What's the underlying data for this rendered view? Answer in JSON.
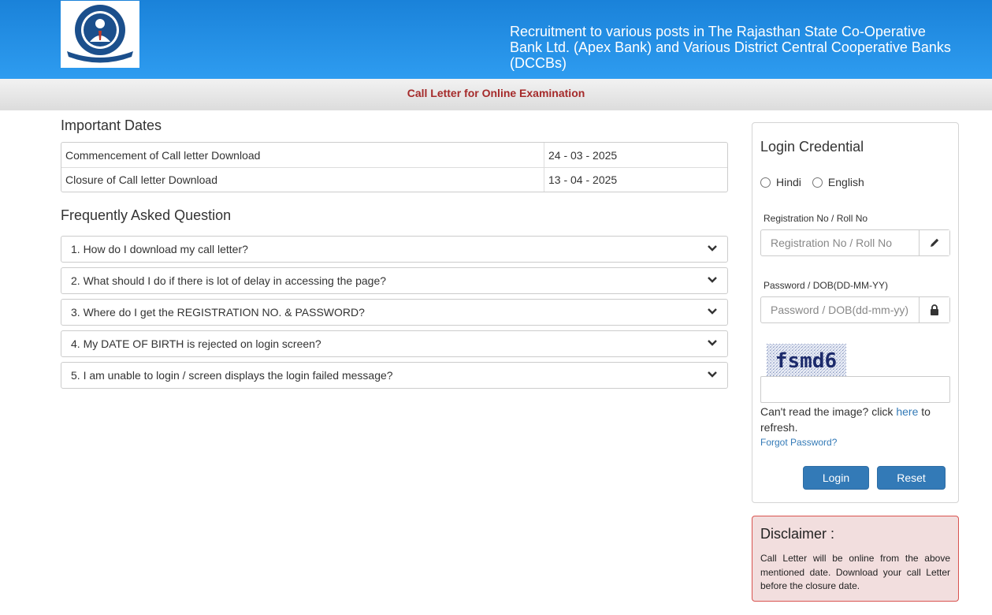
{
  "header": {
    "title": "Recruitment to various posts in The Rajasthan State Co-Operative Bank Ltd. (Apex Bank) and Various District Central Cooperative Banks (DCCBs)"
  },
  "subbar": {
    "text": "Call Letter for Online Examination"
  },
  "important_dates": {
    "heading": "Important Dates",
    "rows": [
      {
        "label": "Commencement of Call letter Download",
        "value": "24 - 03 - 2025"
      },
      {
        "label": "Closure of Call letter Download",
        "value": "13 - 04 - 2025"
      }
    ]
  },
  "faq": {
    "heading": "Frequently Asked Question",
    "items": [
      "1. How do I download my call letter?",
      "2. What should I do if there is lot of delay in accessing the page?",
      "3. Where do I get the REGISTRATION NO. & PASSWORD?",
      "4. My DATE OF BIRTH is rejected on login screen?",
      "5. I am unable to login / screen displays the login failed message?"
    ]
  },
  "login": {
    "title": "Login Credential",
    "language_options": [
      "Hindi",
      "English"
    ],
    "registration_label": "Registration No / Roll No",
    "registration_placeholder": "Registration No / Roll No",
    "password_label": "Password / DOB(DD-MM-YY)",
    "password_placeholder": "Password / DOB(dd-mm-yy)",
    "captcha_text": "fsmd6",
    "captcha_help_prefix": "Can't read the image? click ",
    "captcha_help_link": "here",
    "captcha_help_suffix": " to refresh.",
    "forgot_password": "Forgot Password?",
    "login_button": "Login",
    "reset_button": "Reset"
  },
  "disclaimer": {
    "title": "Disclaimer :",
    "text": "Call Letter will be online from the above mentioned date. Download your call Letter before the closure date."
  },
  "colors": {
    "header_blue": "#1a82d9",
    "button_blue": "#337ab7",
    "subbar_text": "#a52a2a",
    "disclaimer_bg": "#f2dede",
    "disclaimer_border": "#d9534f"
  },
  "icons": [
    "bank-logo-icon",
    "chevron-down-icon",
    "pencil-icon",
    "lock-icon"
  ]
}
